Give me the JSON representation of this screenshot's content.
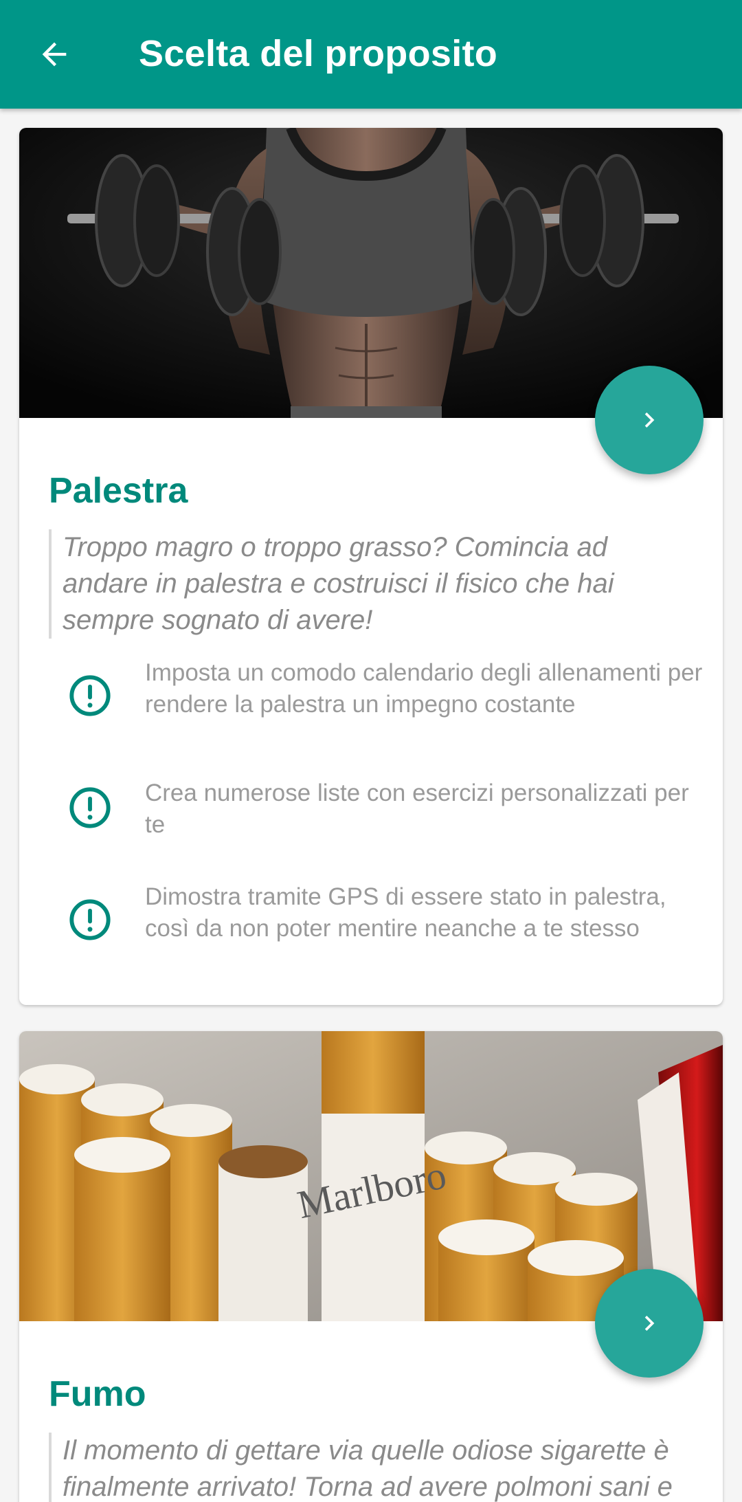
{
  "appbar": {
    "title": "Scelta del proposito",
    "back_icon": "arrow-back-icon",
    "background": "#009688"
  },
  "cards": [
    {
      "title": "Palestra",
      "image": "gym-dumbbells-photo",
      "quote": "Troppo magro o troppo grasso? Comincia ad andare in palestra e costruisci il fisico che hai sempre sognato di avere!",
      "features": [
        {
          "icon": "alert-circle-icon",
          "text": "Imposta un comodo calendario degli allenamenti per rendere la palestra un impegno costante"
        },
        {
          "icon": "alert-circle-icon",
          "text": "Crea numerose liste con esercizi personalizzati per te"
        },
        {
          "icon": "alert-circle-icon",
          "text": "Dimostra tramite GPS di essere stato in palestra, così da non poter mentire neanche a te stesso"
        }
      ]
    },
    {
      "title": "Fumo",
      "image": "cigarettes-pack-photo",
      "image_brand_text": "Marlboro",
      "quote": "Il momento di gettare via quelle odiose sigarette è finalmente arrivato! Torna ad avere polmoni sani e risparmia tutti i soldi che"
    }
  ],
  "colors": {
    "accent": "#26a69a",
    "title": "#00897b",
    "text_secondary": "#9a9a9a"
  }
}
